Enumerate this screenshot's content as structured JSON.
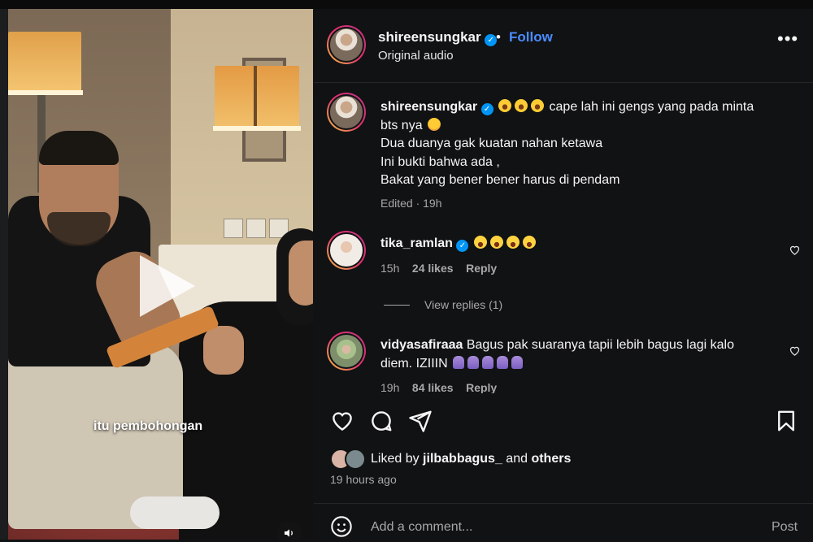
{
  "video": {
    "overlay_caption": "itu pembohongan"
  },
  "post": {
    "username": "shireensungkar",
    "follow_label": "Follow",
    "separator": "•",
    "audio_label": "Original audio",
    "more_label": "•••",
    "caption_emojis": [
      "rolling-on-floor-laughing",
      "rolling-on-floor-laughing",
      "rolling-on-floor-laughing"
    ],
    "caption_line1": "cape lah ini gengs yang pada minta",
    "caption_line1b": "bts nya",
    "caption_line2": "Dua duanya gak kuatan nahan ketawa",
    "caption_line3": "Ini bukti bahwa ada ,",
    "caption_line4": "Bakat yang bener bener harus di pendam",
    "caption_meta": "Edited · 19h"
  },
  "comments": [
    {
      "username": "tika_ramlan",
      "verified": true,
      "text": "",
      "emojis": [
        "grinning-squinting",
        "grinning-squinting",
        "grinning-squinting",
        "grinning-squinting"
      ],
      "time": "15h",
      "likes": "24 likes",
      "reply_label": "Reply",
      "view_replies": "View replies (1)"
    },
    {
      "username": "vidyasafiraaa",
      "verified": false,
      "text_a": "Bagus pak suaranya tapii lebih bagus lagi kalo",
      "text_b": "diem. IZIIIN",
      "emojis": [
        "folded-hands",
        "folded-hands",
        "folded-hands",
        "folded-hands",
        "folded-hands"
      ],
      "time": "19h",
      "likes": "84 likes",
      "reply_label": "Reply"
    }
  ],
  "footer": {
    "liked_prefix": "Liked by",
    "liked_user": "jilbabbagus_",
    "liked_and": "and",
    "liked_others": "others",
    "time_ago": "19 hours ago",
    "add_comment_placeholder": "Add a comment...",
    "post_label": "Post"
  },
  "colors": {
    "accent": "#0095f6",
    "follow": "#4a8cff",
    "background": "#111214",
    "muted": "#a8a8a8"
  },
  "icons": [
    "heart-icon",
    "comment-icon",
    "share-icon",
    "bookmark-icon",
    "emoji-icon",
    "mute-icon",
    "play-icon",
    "verified-icon",
    "more-icon"
  ]
}
